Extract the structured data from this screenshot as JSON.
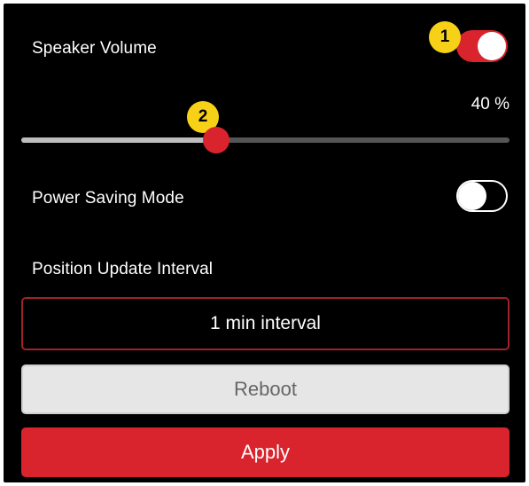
{
  "speaker": {
    "label": "Speaker Volume",
    "toggle_on": true,
    "badge": "1"
  },
  "volume": {
    "value_text": "40 %",
    "level_percent": 40,
    "badge": "2"
  },
  "power_saving": {
    "label": "Power Saving Mode",
    "toggle_on": false
  },
  "position_update": {
    "label": "Position Update Interval",
    "selected": "1 min interval"
  },
  "buttons": {
    "reboot": "Reboot",
    "apply": "Apply"
  },
  "colors": {
    "accent": "#d9232d",
    "badge": "#f7d117",
    "background": "#000000"
  }
}
